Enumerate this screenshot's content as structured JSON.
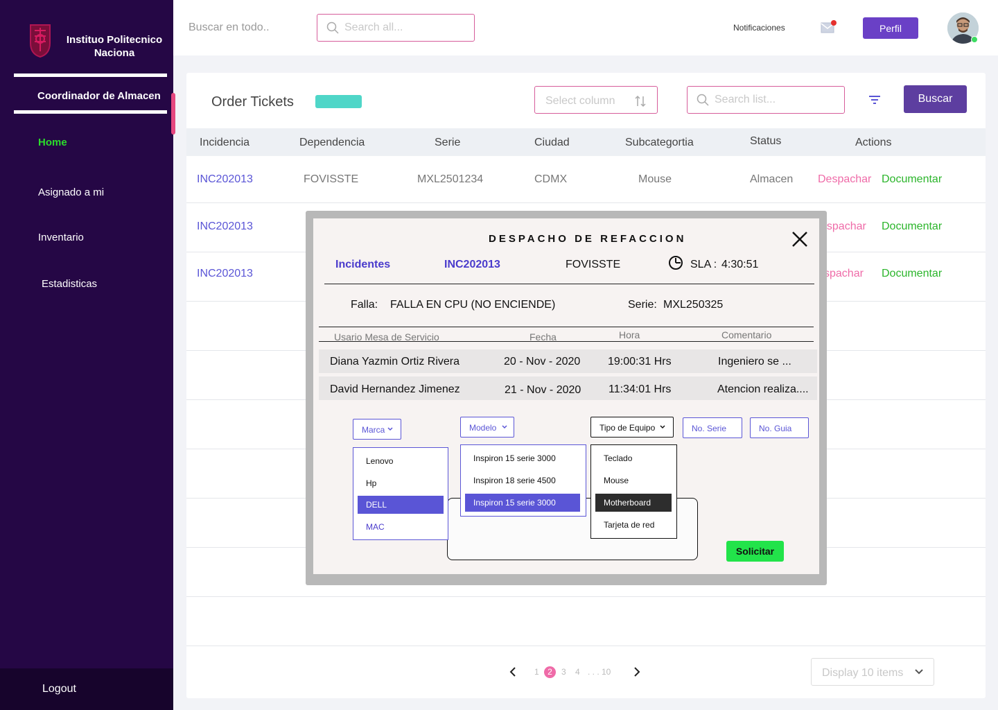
{
  "sidebar": {
    "brand": "Instituo Politecnico Naciona",
    "role": "Coordinador de Almacen",
    "nav": [
      "Home",
      "Asignado a mi",
      "Inventario",
      "Estadisticas"
    ],
    "logout": "Logout",
    "accent_color": "#e5477f"
  },
  "topbar": {
    "search_label": "Buscar en todo..",
    "search_placeholder": "Search all...",
    "notifications": "Notificaciones",
    "profile_button": "Perfil"
  },
  "main": {
    "title": "Order Tickets",
    "select_column_placeholder": "Select column",
    "search_list_placeholder": "Search list...",
    "search_button": "Buscar",
    "columns": [
      "Incidencia",
      "Dependencia",
      "Serie",
      "Ciudad",
      "Subcategortia",
      "Status",
      "Actions"
    ],
    "rows": [
      {
        "incidencia": "INC202013",
        "dependencia": "FOVISSTE",
        "serie": "MXL2501234",
        "ciudad": "CDMX",
        "subcategoria": "Mouse",
        "status": "Almacen",
        "action1": "Despachar",
        "action2": "Documentar"
      },
      {
        "incidencia": "INC202013",
        "dependencia": "",
        "serie": "",
        "ciudad": "",
        "subcategoria": "",
        "status": "",
        "action1": "espachar",
        "action2": "Documentar"
      },
      {
        "incidencia": "INC202013",
        "dependencia": "",
        "serie": "",
        "ciudad": "",
        "subcategoria": "",
        "status": "",
        "action1": "spachar",
        "action2": "Documentar"
      }
    ],
    "pagination": {
      "pages": [
        "1",
        "2",
        "3",
        "4"
      ],
      "ellipsis": ". . . 10",
      "current": "2"
    },
    "display_select": "Display 10 items"
  },
  "modal": {
    "title": "DESPACHO DE REFACCION",
    "incidentes_label": "Incidentes",
    "incident_id": "INC202013",
    "dependencia": "FOVISSTE",
    "sla_label": "SLA :",
    "sla_value": "4:30:51",
    "falla_label": "Falla:",
    "falla_value": "FALLA EN CPU (NO ENCIENDE)",
    "serie_label": "Serie:",
    "serie_value": "MXL250325",
    "history_columns": [
      "Usario Mesa de Servicio",
      "Fecha",
      "Hora",
      "Comentario"
    ],
    "history": [
      {
        "usuario": "Diana Yazmin Ortiz Rivera",
        "fecha": "20 - Nov - 2020",
        "hora": "19:00:31 Hrs",
        "comentario": "Ingeniero se ..."
      },
      {
        "usuario": "David Hernandez Jimenez",
        "fecha": "21 - Nov - 2020",
        "hora": "11:34:01 Hrs",
        "comentario": "Atencion realiza...."
      }
    ],
    "marca_label": "Marca",
    "marca_options": [
      "Lenovo",
      "Hp",
      "DELL",
      "MAC"
    ],
    "modelo_label": "Modelo",
    "modelo_options": [
      "Inspiron 15 serie 3000",
      "Inspiron 18 serie 4500",
      "Inspiron 15 serie 3000"
    ],
    "tipo_label": "Tipo de Equipo",
    "tipo_options": [
      "Teclado",
      "Mouse",
      "Motherboard",
      "Tarjeta de red"
    ],
    "no_serie_label": "No. Serie",
    "no_guia_label": "No. Guia",
    "solicitar": "Solicitar"
  },
  "icons": {
    "search": "search-icon",
    "sort": "sort-icon",
    "filter": "filter-icon",
    "mail": "mail-icon",
    "clock": "clock-icon",
    "close": "close-icon",
    "chevron": "chevron-down-icon"
  },
  "colors": {
    "sidebar_bg": "#250745",
    "primary": "#5d3ea0",
    "link": "#5a55d6",
    "pink": "#ef6ba8",
    "green": "#2bb52b",
    "teal": "#4fd6c8",
    "solicitar": "#22e34a"
  }
}
